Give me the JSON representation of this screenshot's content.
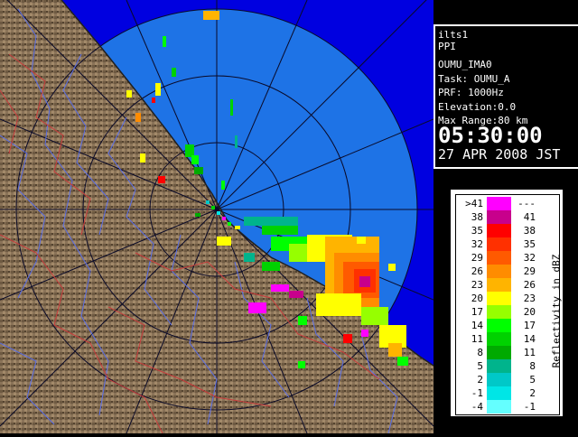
{
  "info": {
    "station": "ilts1",
    "scan_type": "PPI",
    "product": "OUMU_IMA0",
    "task": "Task: OUMU_A",
    "prf": "PRF: 1000Hz",
    "elevation": "Elevation:0.0",
    "max_range": "Max Range:80 km",
    "time": "05:30:00",
    "date": "27 APR 2008 JST"
  },
  "legend": {
    "title": "Reflectivity in dBZ",
    "rows": [
      {
        "lo": ">41",
        "hi": "---",
        "color": "#ff00ff"
      },
      {
        "lo": "38",
        "hi": "41",
        "color": "#c8008c"
      },
      {
        "lo": "35",
        "hi": "38",
        "color": "#ff0000"
      },
      {
        "lo": "32",
        "hi": "35",
        "color": "#ff3000"
      },
      {
        "lo": "29",
        "hi": "32",
        "color": "#ff5a00"
      },
      {
        "lo": "26",
        "hi": "29",
        "color": "#ff8c00"
      },
      {
        "lo": "23",
        "hi": "26",
        "color": "#ffb400"
      },
      {
        "lo": "20",
        "hi": "23",
        "color": "#ffff00"
      },
      {
        "lo": "17",
        "hi": "20",
        "color": "#96ff00"
      },
      {
        "lo": "14",
        "hi": "17",
        "color": "#00ff00"
      },
      {
        "lo": "11",
        "hi": "14",
        "color": "#00d200"
      },
      {
        "lo": "8",
        "hi": "11",
        "color": "#00aa00"
      },
      {
        "lo": "5",
        "hi": "8",
        "color": "#00b48c"
      },
      {
        "lo": "2",
        "hi": "5",
        "color": "#00c8c8"
      },
      {
        "lo": "-1",
        "hi": "2",
        "color": "#00e6e6"
      },
      {
        "lo": "-4",
        "hi": "-1",
        "color": "#64ffff"
      }
    ]
  },
  "map": {
    "land_color": "#8a7358",
    "sea_color": "#1e73e6",
    "outer_color": "#0000e0",
    "range_ring_color": "#0a0a28",
    "river_color": "#5a6ee6",
    "border_color": "#c83c3c"
  }
}
